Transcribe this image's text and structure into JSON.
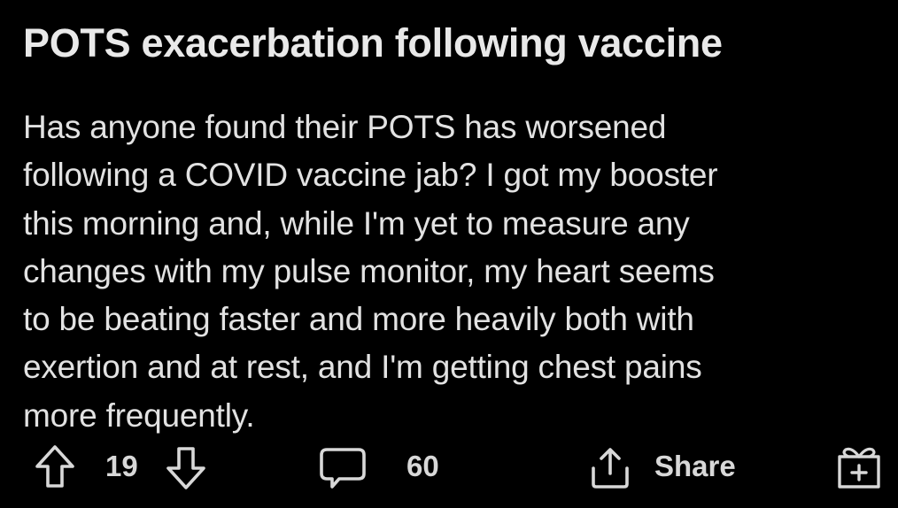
{
  "post": {
    "title": "POTS exacerbation following vaccine",
    "body_lines": [
      "Has anyone found their POTS has worsened",
      "following a COVID vaccine jab? I got my booster",
      "this morning and, while I'm yet to measure any",
      "changes with my pulse monitor, my heart seems",
      "to be beating faster and more heavily both with",
      "exertion and at rest, and I'm getting chest pains",
      "more frequently."
    ]
  },
  "actions": {
    "upvote_icon": "arrow-up-icon",
    "vote_count": "19",
    "downvote_icon": "arrow-down-icon",
    "comment_icon": "speech-bubble-icon",
    "comment_count": "60",
    "share_icon": "share-upload-icon",
    "share_label": "Share",
    "award_icon": "gift-box-icon"
  },
  "colors": {
    "background": "#000000",
    "text": "#e2e2e2",
    "icon": "#d8d8d8"
  }
}
